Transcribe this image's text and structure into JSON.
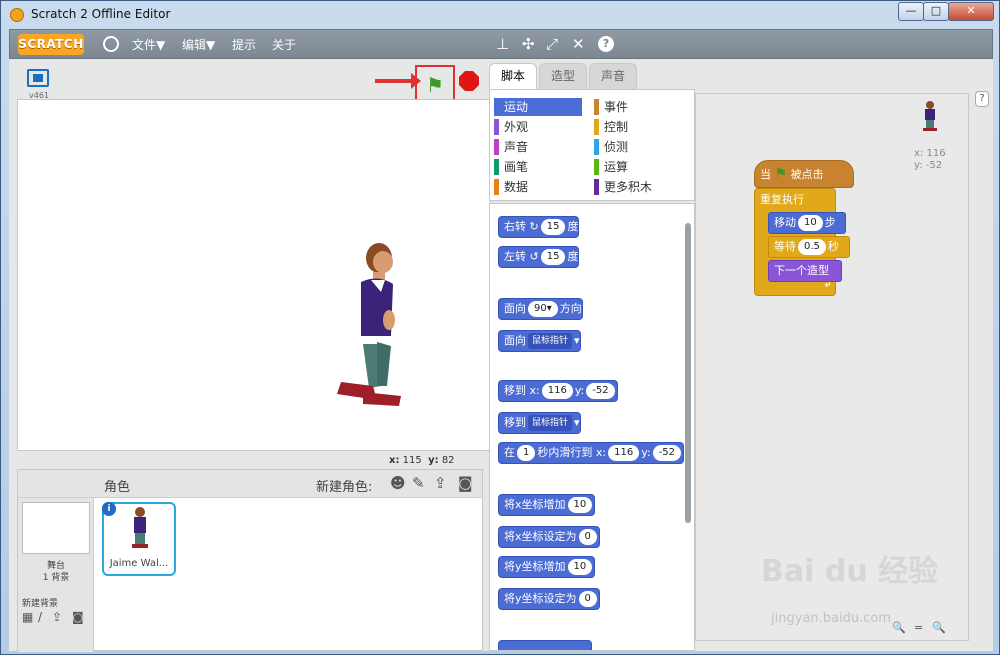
{
  "window": {
    "title": "Scratch 2 Offline Editor",
    "controls": [
      "—",
      "□",
      "✕"
    ]
  },
  "menubar": {
    "logo": "SCRATCH",
    "items": [
      "文件▼",
      "编辑▼",
      "提示",
      "关于"
    ],
    "tools": [
      "stamp-icon",
      "shrink-icon",
      "grow-icon",
      "unexpand-icon",
      "help-icon"
    ]
  },
  "stage": {
    "version": "v461",
    "mouse_x_label": "x:",
    "mouse_x": "115",
    "mouse_y_label": "y:",
    "mouse_y": "82"
  },
  "sprites": {
    "header": "角色",
    "new_sprite": "新建角色:",
    "stage_label": "舞台",
    "backdrop_count": "1 背景",
    "new_backdrop": "新建背景",
    "sprite_name": "Jaime Wal...",
    "info": "i"
  },
  "tabs": [
    "脚本",
    "造型",
    "声音"
  ],
  "categories": {
    "left": [
      {
        "label": "运动",
        "color": "#4a6cd4",
        "selected": true
      },
      {
        "label": "外观",
        "color": "#8a55d7"
      },
      {
        "label": "声音",
        "color": "#bb42c3"
      },
      {
        "label": "画笔",
        "color": "#0e9a6c"
      },
      {
        "label": "数据",
        "color": "#ee7d16"
      }
    ],
    "right": [
      {
        "label": "事件",
        "color": "#c88330"
      },
      {
        "label": "控制",
        "color": "#e1a91a"
      },
      {
        "label": "侦测",
        "color": "#2ca5e2"
      },
      {
        "label": "运算",
        "color": "#5cb712"
      },
      {
        "label": "更多积木",
        "color": "#632d99"
      }
    ]
  },
  "palette": {
    "turn_right": "右转",
    "turn_right_val": "15",
    "turn_unit": "度",
    "turn_left": "左转",
    "turn_left_val": "15",
    "point_dir": "面向",
    "point_dir_val": "90▾",
    "point_dir_suffix": "方向",
    "point_towards": "面向",
    "point_towards_val": "鼠标指针",
    "goto_xy": "移到",
    "goto_x_label": "x:",
    "goto_x": "116",
    "goto_y_label": "y:",
    "goto_y": "-52",
    "goto": "移到",
    "goto_val": "鼠标指针",
    "glide_prefix": "在",
    "glide_secs": "1",
    "glide_mid": "秒内滑行到",
    "glide_x_label": "x:",
    "glide_x": "116",
    "glide_y_label": "y:",
    "glide_y": "-52",
    "change_x": "将x坐标增加",
    "change_x_val": "10",
    "set_x": "将x坐标设定为",
    "set_x_val": "0",
    "change_y": "将y坐标增加",
    "change_y_val": "10",
    "set_y": "将y坐标设定为",
    "set_y_val": "0"
  },
  "script": {
    "sprite_x_label": "x:",
    "sprite_x": "116",
    "sprite_y_label": "y:",
    "sprite_y": "-52",
    "when_prefix": "当",
    "when_suffix": "被点击",
    "forever": "重复执行",
    "move": "移动",
    "move_val": "10",
    "move_unit": "步",
    "wait": "等待",
    "wait_val": "0.5",
    "wait_unit": "秒",
    "next_costume": "下一个造型",
    "zoom_in": "🔍",
    "zoom_reset": "=",
    "zoom_out": "🔍"
  },
  "watermark": {
    "brand": "Bai du 经验",
    "url": "jingyan.baidu.com"
  }
}
